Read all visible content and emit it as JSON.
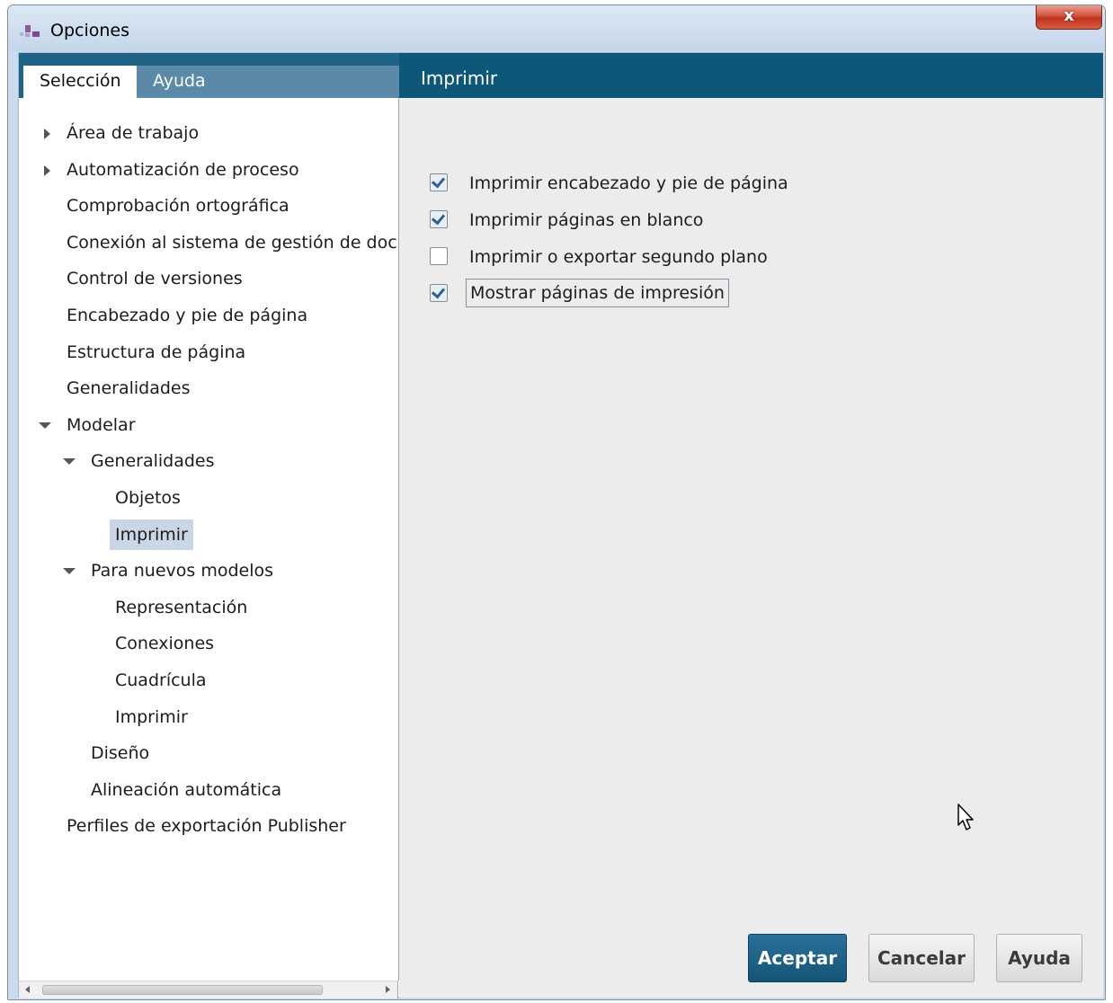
{
  "window": {
    "title": "Opciones",
    "close_glyph": "x"
  },
  "tabs": [
    {
      "label": "Selección",
      "active": true
    },
    {
      "label": "Ayuda",
      "active": false
    }
  ],
  "tree": {
    "items": [
      {
        "label": "Área de trabajo",
        "level": 0,
        "expander": "collapsed"
      },
      {
        "label": "Automatización de proceso",
        "level": 0,
        "expander": "collapsed"
      },
      {
        "label": "Comprobación ortográfica",
        "level": 0,
        "expander": "none"
      },
      {
        "label": "Conexión al sistema de gestión de docum",
        "level": 0,
        "expander": "none"
      },
      {
        "label": "Control de versiones",
        "level": 0,
        "expander": "none"
      },
      {
        "label": "Encabezado y pie de página",
        "level": 0,
        "expander": "none"
      },
      {
        "label": "Estructura de página",
        "level": 0,
        "expander": "none"
      },
      {
        "label": "Generalidades",
        "level": 0,
        "expander": "none"
      },
      {
        "label": "Modelar",
        "level": 0,
        "expander": "expanded"
      },
      {
        "label": "Generalidades",
        "level": 1,
        "expander": "expanded"
      },
      {
        "label": "Objetos",
        "level": 2,
        "expander": "none"
      },
      {
        "label": "Imprimir",
        "level": 2,
        "expander": "none",
        "selected": true
      },
      {
        "label": "Para nuevos modelos",
        "level": 1,
        "expander": "expanded"
      },
      {
        "label": "Representación",
        "level": 2,
        "expander": "none"
      },
      {
        "label": "Conexiones",
        "level": 2,
        "expander": "none"
      },
      {
        "label": "Cuadrícula",
        "level": 2,
        "expander": "none"
      },
      {
        "label": "Imprimir",
        "level": 2,
        "expander": "none"
      },
      {
        "label": "Diseño",
        "level": 1,
        "expander": "none"
      },
      {
        "label": "Alineación automática",
        "level": 1,
        "expander": "none"
      },
      {
        "label": "Perfiles de exportación Publisher",
        "level": 0,
        "expander": "none"
      }
    ]
  },
  "content": {
    "header": "Imprimir",
    "options": [
      {
        "label": "Imprimir encabezado y pie de página",
        "checked": true,
        "focused": false
      },
      {
        "label": "Imprimir páginas en blanco",
        "checked": true,
        "focused": false
      },
      {
        "label": "Imprimir o exportar segundo plano",
        "checked": false,
        "focused": false
      },
      {
        "label": "Mostrar páginas de impresión",
        "checked": true,
        "focused": true
      }
    ]
  },
  "buttons": {
    "ok": "Aceptar",
    "cancel": "Cancelar",
    "help": "Ayuda"
  },
  "colors": {
    "header_bg": "#0d5879",
    "tab_bar_bg": "#1e6285",
    "selected_item_bg": "#c8d6e5",
    "primary_button": "#145577",
    "check_color": "#2f5f8f"
  }
}
